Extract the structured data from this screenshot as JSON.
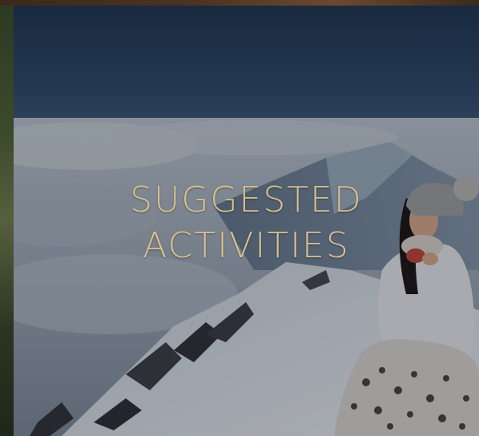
{
  "hero": {
    "title_line1": "SUGGESTED",
    "title_line2": "ACTIVITIES",
    "title_color": "#d9c08f",
    "image_subject": "person sitting on snowy mountain summit above clouds"
  }
}
